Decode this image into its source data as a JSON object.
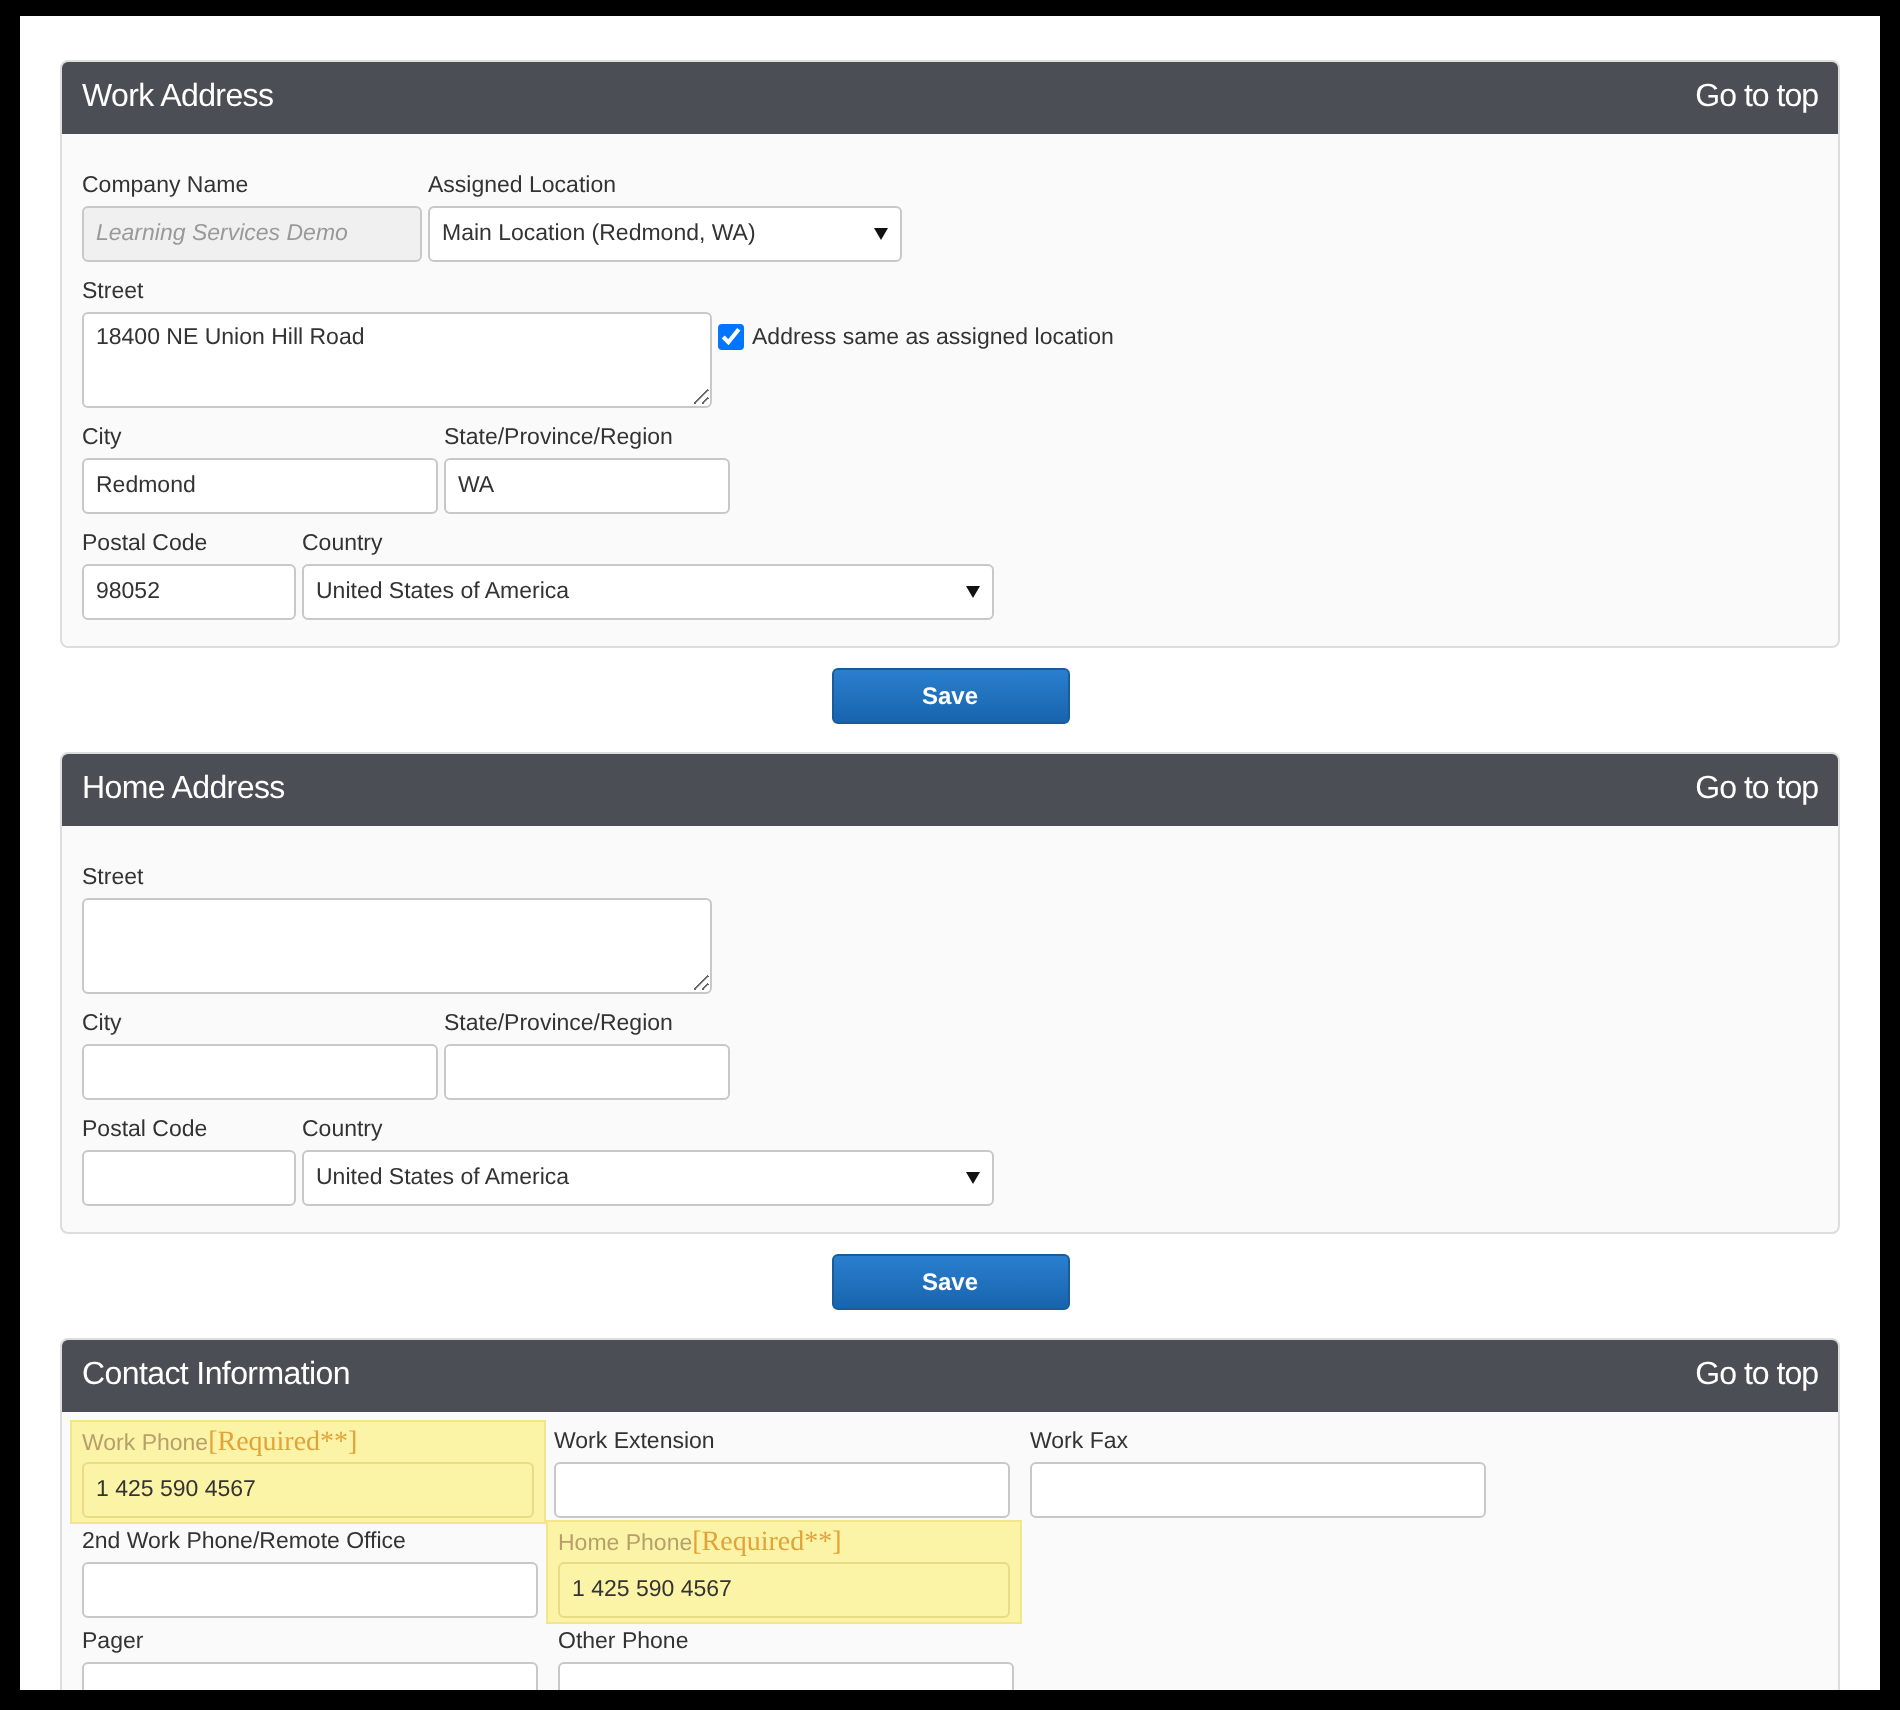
{
  "sections": [
    {
      "title": "Work Address",
      "link": "Go to top",
      "save_button": "Save",
      "rows": [
        [
          {
            "kind": "text",
            "label": "Company Name",
            "value": "Learning Services Demo",
            "disabled": true,
            "highlighted": false
          },
          {
            "kind": "select",
            "label": "Assigned Location",
            "value": "Main Location (Redmond, WA)",
            "disabled": false,
            "highlighted": false
          }
        ],
        [
          {
            "kind": "textarea",
            "label": "Street",
            "value": "18400 NE Union Hill Road",
            "disabled": false,
            "highlighted": false
          },
          {
            "kind": "checkbox",
            "label": "Address same as assigned location",
            "checked": true,
            "disabled": false,
            "highlighted": false
          }
        ],
        [
          {
            "kind": "text",
            "label": "City",
            "value": "Redmond",
            "disabled": false,
            "highlighted": false
          },
          {
            "kind": "text",
            "label": "State/Province/Region",
            "value": "WA",
            "disabled": false,
            "highlighted": false
          }
        ],
        [
          {
            "kind": "text",
            "label": "Postal Code",
            "value": "98052",
            "disabled": false,
            "highlighted": false
          },
          {
            "kind": "select",
            "label": "Country",
            "value": "United States of America",
            "disabled": false,
            "highlighted": false
          }
        ]
      ]
    },
    {
      "title": "Home Address",
      "link": "Go to top",
      "save_button": "Save",
      "rows": [
        [
          {
            "kind": "textarea",
            "label": "Street",
            "disabled": false,
            "highlighted": false
          }
        ],
        [
          {
            "kind": "text",
            "label": "City",
            "disabled": false,
            "highlighted": false
          },
          {
            "kind": "text",
            "label": "State/Province/Region",
            "disabled": false,
            "highlighted": false
          }
        ],
        [
          {
            "kind": "text",
            "label": "Postal Code",
            "disabled": false,
            "highlighted": false
          },
          {
            "kind": "select",
            "label": "Country",
            "value": "United States of America",
            "disabled": false,
            "highlighted": false
          }
        ]
      ]
    },
    {
      "title": "Contact Information",
      "link": "Go to top",
      "rows": [
        [
          {
            "kind": "text",
            "label": "Work Phone",
            "required_tag": "[Required**]",
            "value": "1 425 590 4567",
            "disabled": false,
            "highlighted": true
          },
          {
            "kind": "text",
            "label": "Work Extension",
            "disabled": false,
            "highlighted": false
          },
          {
            "kind": "text",
            "label": "Work Fax",
            "disabled": false,
            "highlighted": false
          }
        ],
        [
          {
            "kind": "text",
            "label": "2nd Work Phone/Remote Office",
            "disabled": false,
            "highlighted": false
          },
          {
            "kind": "text",
            "label": "Home Phone",
            "required_tag": "[Required**]",
            "value": "1 425 590 4567",
            "disabled": false,
            "highlighted": true
          }
        ],
        [
          {
            "kind": "text",
            "label": "Pager",
            "disabled": false,
            "highlighted": false
          },
          {
            "kind": "text",
            "label": "Other Phone",
            "disabled": false,
            "highlighted": false
          }
        ]
      ]
    }
  ]
}
